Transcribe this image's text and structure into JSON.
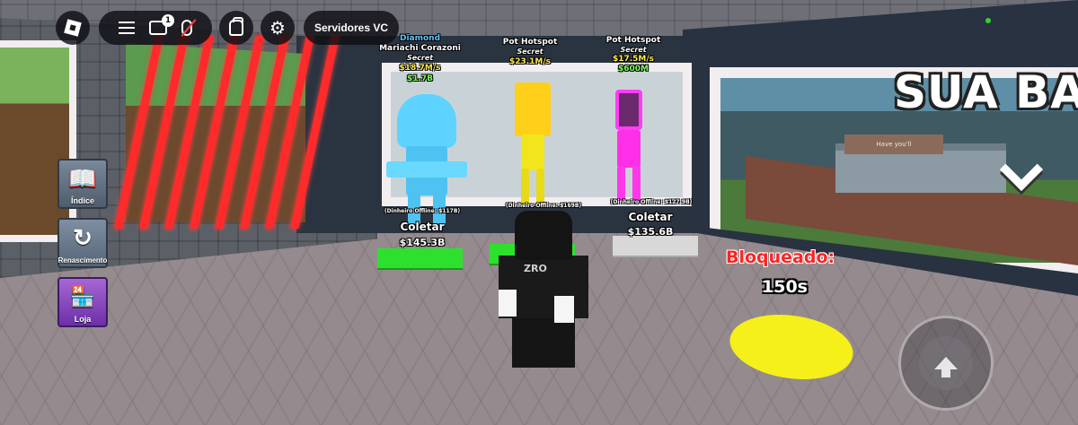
{
  "hud": {
    "chat_badge": "1",
    "servers_label": "Servidores VC"
  },
  "side_menu": {
    "index_label": "Índice",
    "rebirth_label": "Renascimento",
    "shop_label": "Loja"
  },
  "brainrots": [
    {
      "rarity": "Diamond",
      "rarity_color": "#5ec8ff",
      "name": "Mariachi Corazoni",
      "tier": "Secret",
      "rate": "$18.7M/s",
      "value": "$1.7B",
      "offline": "(Dinheiro Offline: $117B)",
      "collect": "Coletar",
      "cash": "$145.3B"
    },
    {
      "rarity": "",
      "name": "Pot Hotspot",
      "tier": "Secret",
      "rate": "$23.1M/s",
      "value": "",
      "offline": "(Dinheiro Offline: $169B)",
      "collect": "",
      "cash": ""
    },
    {
      "rarity": "",
      "name": "Pot Hotspot",
      "tier": "Secret",
      "rate": "$17.5M/s",
      "value": "$600M",
      "offline": "(Dinheiro Offline: $127.9B)",
      "collect": "Coletar",
      "cash": "$135.6B"
    }
  ],
  "base": {
    "title": "SUA BA",
    "sign": "Have you'll",
    "locked_label": "Bloqueado:",
    "locked_timer": "150s"
  },
  "colors": {
    "lock_red": "#ff2424",
    "pedestal_green": "#2ee02e",
    "yellow_pad": "#f5ef1a"
  }
}
